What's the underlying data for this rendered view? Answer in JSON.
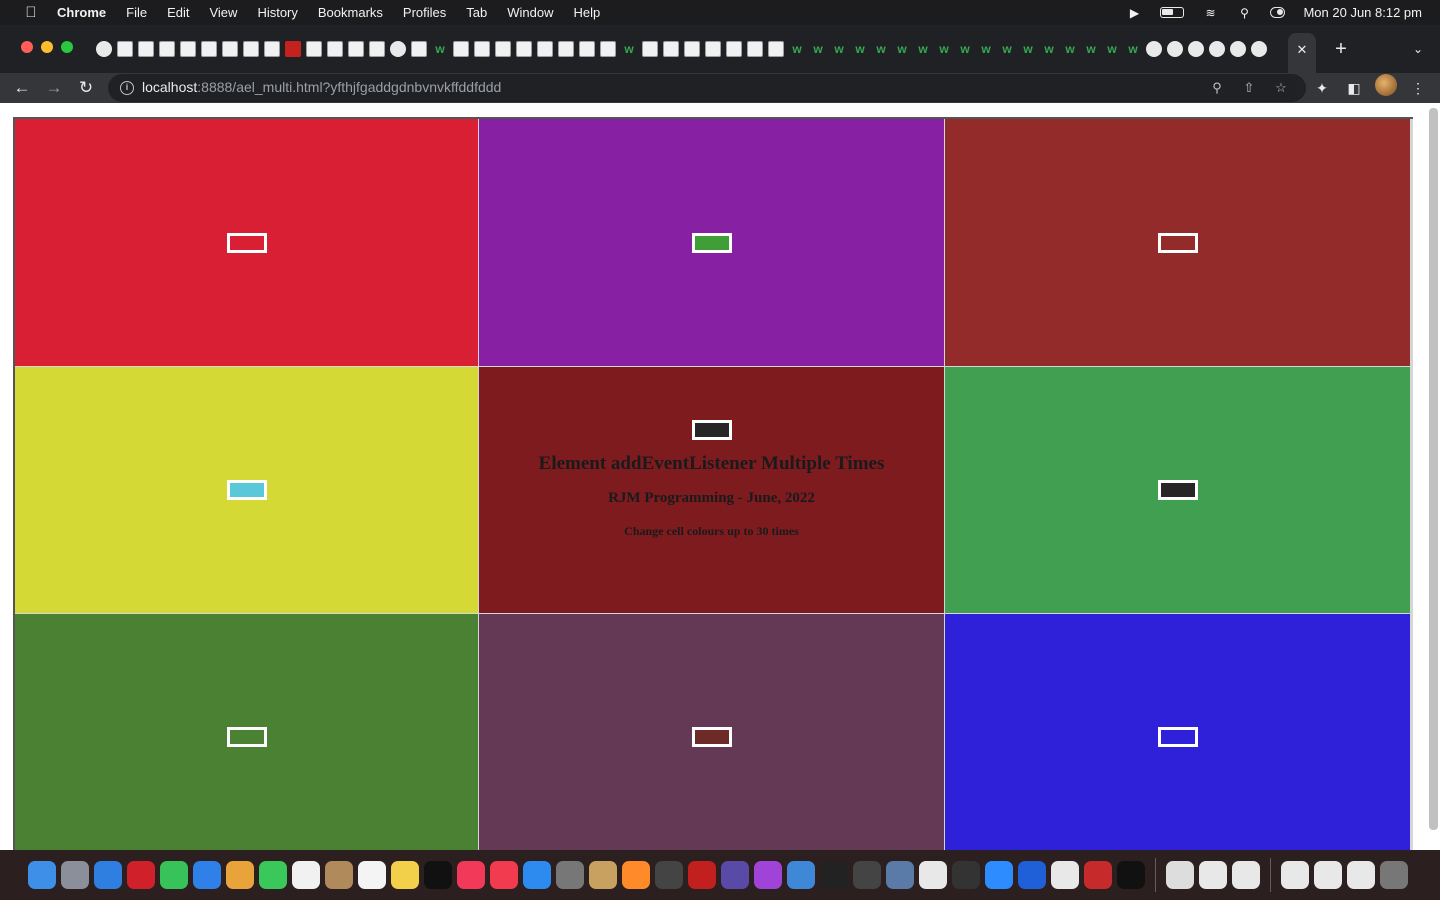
{
  "menubar": {
    "apple_icon": "apple-logo-icon",
    "items": [
      "Chrome",
      "File",
      "Edit",
      "View",
      "History",
      "Bookmarks",
      "Profiles",
      "Tab",
      "Window",
      "Help"
    ],
    "datetime": "Mon 20 Jun  8:12 pm"
  },
  "browser": {
    "url_host": "localhost",
    "url_rest": ":8888/ael_multi.html?yfthjfgaddgdnbvnvkffddfddd"
  },
  "page": {
    "heading": "Element addEventListener Multiple Times",
    "subheading": "RJM Programming - June, 2022",
    "note": "Change cell colours up to 30 times",
    "cells": [
      {
        "bg": "#d91f34",
        "swatch": "#d91f34"
      },
      {
        "bg": "#8820a4",
        "swatch": "#3f9e35"
      },
      {
        "bg": "#932b2a",
        "swatch": "#932b2a"
      },
      {
        "bg": "#d4d936",
        "swatch": "#5bc8d9"
      },
      {
        "bg": "#7e1b1f",
        "swatch": "#272525"
      },
      {
        "bg": "#409f50",
        "swatch": "#272525"
      },
      {
        "bg": "#4a8133",
        "swatch": "#4a8133"
      },
      {
        "bg": "#643955",
        "swatch": "#6e2a26"
      },
      {
        "bg": "#2f20da",
        "swatch": "#2f20da"
      }
    ]
  },
  "dock_colors": [
    "#3d8fe8",
    "#8a8f9a",
    "#2f7fe0",
    "#d0202a",
    "#38c35a",
    "#2f80e8",
    "#e8a33a",
    "#3ac85a",
    "#f1f1f1",
    "#b08a5a",
    "#f4f4f4",
    "#f3d04a",
    "#111111",
    "#f2395a",
    "#f23b4f",
    "#2d8bf0",
    "#777777",
    "#c8a060",
    "#ff8a2a",
    "#444444",
    "#c21f1f",
    "#5a4aa8",
    "#a043d8",
    "#3f88d8",
    "#222222",
    "#444444",
    "#5a7aa8",
    "#e8e8e8",
    "#333333",
    "#2d8cff",
    "#1f5fd8",
    "#e8e8e8",
    "#c72a2a",
    "#111111",
    "#dddddd",
    "#e8e8e8",
    "#e8e8e8",
    "#e8e8e8",
    "#e8e8e8",
    "#e8e8e8",
    "#777777"
  ]
}
